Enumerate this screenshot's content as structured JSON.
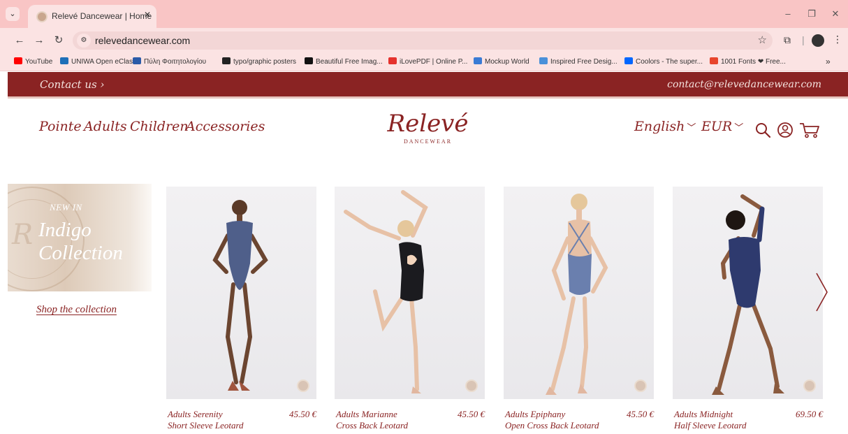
{
  "browser": {
    "tab_title": "Relevé Dancewear | Home",
    "url": "relevedancewear.com",
    "bookmarks": [
      {
        "label": "YouTube",
        "color": "#ff0000"
      },
      {
        "label": "UNIWA Open eClass",
        "color": "#1e6fb8"
      },
      {
        "label": "Πύλη Φοιτητολογίου",
        "color": "#2b5ba8"
      },
      {
        "label": "typo/graphic posters",
        "color": "#222222"
      },
      {
        "label": "Beautiful Free Imag...",
        "color": "#111111"
      },
      {
        "label": "iLovePDF | Online P...",
        "color": "#e5322d"
      },
      {
        "label": "Mockup World",
        "color": "#3a7bd5"
      },
      {
        "label": "Inspired Free Desig...",
        "color": "#4a90d9"
      },
      {
        "label": "Coolors - The super...",
        "color": "#0066ff"
      },
      {
        "label": "1001 Fonts ❤ Free...",
        "color": "#e8452c"
      }
    ]
  },
  "promo": {
    "contact_label": "Contact us ›",
    "email": "contact@relevedancewear.com"
  },
  "nav": {
    "items": [
      "Pointe",
      "Adults",
      "Children",
      "Accessories"
    ]
  },
  "logo": {
    "main": "Relevé",
    "sub": "DANCEWEAR"
  },
  "selectors": {
    "language": "English",
    "currency": "EUR"
  },
  "hero": {
    "eyebrow": "NEW IN",
    "title_line1": "Indigo",
    "title_line2": "Collection",
    "cta": "Shop the collection"
  },
  "products": [
    {
      "name_line1": "Adults Serenity",
      "name_line2": "Short Sleeve Leotard",
      "price": "45.50 €",
      "leotard_color": "#4f5f8a"
    },
    {
      "name_line1": "Adults Marianne",
      "name_line2": "Cross Back Leotard",
      "price": "45.50 €",
      "leotard_color": "#1b1b1f"
    },
    {
      "name_line1": "Adults Epiphany",
      "name_line2": "Open Cross Back Leotard",
      "price": "45.50 €",
      "leotard_color": "#6a7fae"
    },
    {
      "name_line1": "Adults Midnight",
      "name_line2": "Half Sleeve Leotard",
      "price": "69.50 €",
      "leotard_color": "#2e3a6e"
    }
  ],
  "colors": {
    "brand": "#8a2323",
    "tabbar": "#f9c5c5",
    "chrome": "#fbe3e3"
  }
}
